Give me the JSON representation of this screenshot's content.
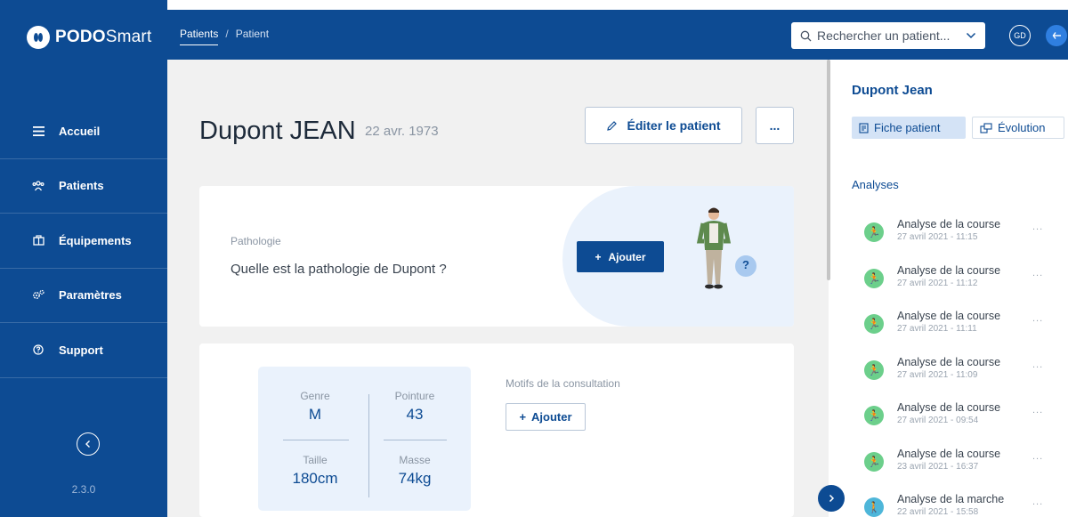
{
  "app": {
    "logo_bold": "PODO",
    "logo_light": "Smart",
    "version": "2.3.0"
  },
  "breadcrumb": {
    "items": [
      "Patients",
      "Patient"
    ],
    "separator": "/"
  },
  "search": {
    "placeholder": "Rechercher un patient..."
  },
  "user": {
    "initials": "GD"
  },
  "sidebar": {
    "items": [
      {
        "label": "Accueil",
        "icon": "menu-icon"
      },
      {
        "label": "Patients",
        "icon": "users-icon"
      },
      {
        "label": "Équipements",
        "icon": "equipment-icon"
      },
      {
        "label": "Paramètres",
        "icon": "settings-icon"
      },
      {
        "label": "Support",
        "icon": "help-icon"
      }
    ]
  },
  "patient": {
    "name": "Dupont JEAN",
    "birth_date": "22 avr. 1973"
  },
  "actions": {
    "edit_label": "Éditer le patient",
    "more_label": "..."
  },
  "pathology": {
    "label": "Pathologie",
    "question": "Quelle est la pathologie de Dupont ?",
    "add_label": "Ajouter",
    "help_mark": "?"
  },
  "stats": {
    "gender": {
      "label": "Genre",
      "value": "M"
    },
    "shoe_size": {
      "label": "Pointure",
      "value": "43"
    },
    "height": {
      "label": "Taille",
      "value": "180cm"
    },
    "mass": {
      "label": "Masse",
      "value": "74kg"
    }
  },
  "consultation": {
    "label": "Motifs de la consultation",
    "add_label": "Ajouter"
  },
  "right_panel": {
    "name": "Dupont Jean",
    "tab_sheet": "Fiche patient",
    "tab_evolution": "Évolution",
    "analyses_title": "Analyses",
    "analyses": [
      {
        "title": "Analyse de la course",
        "date": "27 avril 2021 - 11:15",
        "type": "run"
      },
      {
        "title": "Analyse de la course",
        "date": "27 avril 2021 - 11:12",
        "type": "run"
      },
      {
        "title": "Analyse de la course",
        "date": "27 avril 2021 - 11:11",
        "type": "run"
      },
      {
        "title": "Analyse de la course",
        "date": "27 avril 2021 - 11:09",
        "type": "run"
      },
      {
        "title": "Analyse de la course",
        "date": "27 avril 2021 - 09:54",
        "type": "run"
      },
      {
        "title": "Analyse de la course",
        "date": "23 avril 2021 - 16:37",
        "type": "run"
      },
      {
        "title": "Analyse de la marche",
        "date": "22 avril 2021 - 15:58",
        "type": "walk"
      }
    ],
    "item_more": "..."
  },
  "colors": {
    "brand": "#0d4b93",
    "run": "#6ccf8b",
    "walk": "#4eb6d9",
    "panel_tint": "#eaf2fc"
  }
}
